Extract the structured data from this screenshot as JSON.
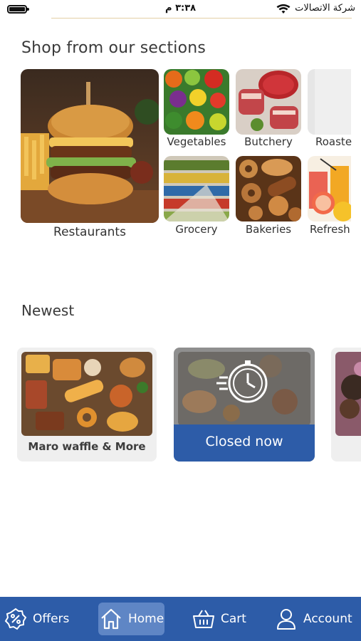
{
  "status_bar": {
    "time": "٣:٣٨ م",
    "carrier": "شركة الاتصالات"
  },
  "sections": {
    "title": "Shop from our sections",
    "items": [
      {
        "label": "Restaurants"
      },
      {
        "label": "Vegetables"
      },
      {
        "label": "Butchery"
      },
      {
        "label": "Roaste"
      },
      {
        "label": "Grocery"
      },
      {
        "label": "Bakeries"
      },
      {
        "label": "Refresh"
      }
    ]
  },
  "newest": {
    "title": "Newest",
    "cards": [
      {
        "name": "Maro waffle & More"
      },
      {
        "status": "Closed now"
      }
    ]
  },
  "bottom_nav": {
    "items": [
      {
        "label": "Offers",
        "icon": "offers-icon"
      },
      {
        "label": "Home",
        "icon": "home-icon",
        "active": true
      },
      {
        "label": "Cart",
        "icon": "cart-icon"
      },
      {
        "label": "Account",
        "icon": "account-icon"
      }
    ]
  },
  "colors": {
    "brand": "#2d5ca8",
    "active_nav": "#5f86c5",
    "card_bg": "#efefef"
  }
}
